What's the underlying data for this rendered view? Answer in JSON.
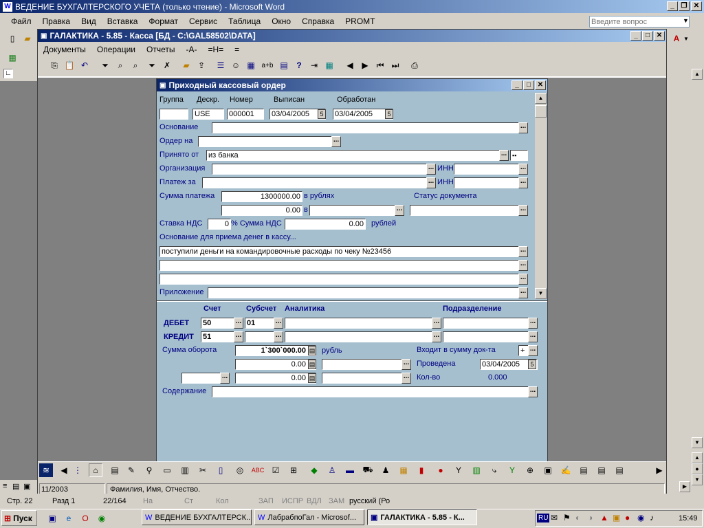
{
  "word": {
    "title": "ВЕДЕНИЕ БУХГАЛТЕРСКОГО УЧЕТА (только чтение) - Microsoft Word",
    "menu": [
      "Файл",
      "Правка",
      "Вид",
      "Вставка",
      "Формат",
      "Сервис",
      "Таблица",
      "Окно",
      "Справка",
      "PROMT"
    ],
    "help_placeholder": "Введите вопрос",
    "status": {
      "page": "Стр. 22",
      "section": "Разд 1",
      "pages": "22/164",
      "at": "На",
      "line": "Ст",
      "col": "Кол",
      "rec": "ЗАП",
      "trk": "ИСПР",
      "ext": "ВДЛ",
      "ovr": "ЗАМ",
      "lang": "русский (Ро"
    }
  },
  "galaktika": {
    "title": "ГАЛАКТИКА - 5.85 - Касса [БД - C:\\GAL58502\\DATA]",
    "menu": [
      "Документы",
      "Операции",
      "Отчеты",
      "-A-",
      "=H=",
      "="
    ],
    "status_period": "11/2003",
    "status_hint": "Фамилия, Имя, Отчество."
  },
  "order": {
    "title": "Приходный кассовый ордер",
    "labels": {
      "group": "Группа",
      "descr": "Дескр.",
      "number": "Номер",
      "issued": "Выписан",
      "processed": "Обработан",
      "basis": "Основание",
      "order_to": "Ордер на",
      "received_from": "Принято от",
      "organization": "Организация",
      "inn": "ИНН",
      "payment_for": "Платеж за",
      "payment_sum": "Сумма платежа",
      "in_rubles": "в рублях",
      "in": "в",
      "doc_status": "Статус документа",
      "vat_rate": "Ставка НДС",
      "vat_sum": "% Сумма НДС",
      "rubles": "рублей",
      "cash_basis": "Основание для приема денег в кассу...",
      "attachment": "Приложение"
    },
    "values": {
      "group": "",
      "descr": "USE",
      "number": "000001",
      "issued": "03/04/2005",
      "processed": "03/04/2005",
      "received_from": "из банка",
      "received_extra": "▪▪",
      "payment_sum": "1300000.00",
      "payment_sum2": "0.00",
      "vat_rate": "0",
      "vat_sum": "0.00",
      "cash_basis_1": "поступили деньги на командировочные расходы по чеку №23456"
    },
    "posting": {
      "h_account": "Счет",
      "h_subaccount": "Субсчет",
      "h_analytics": "Аналитика",
      "h_division": "Подразделение",
      "debit": "ДЕБЕТ",
      "credit": "КРЕДИТ",
      "debit_account": "50",
      "debit_sub": "01",
      "credit_account": "51",
      "credit_sub": "",
      "turnover_label": "Сумма оборота",
      "turnover": "1`300`000.00",
      "ruble": "рубль",
      "turnover2": "0.00",
      "turnover3": "0.00",
      "included_label": "Входит в сумму док-та",
      "included": "+",
      "posted_label": "Проведена",
      "posted": "03/04/2005",
      "qty_label": "Кол-во",
      "qty": "0.000",
      "content_label": "Содержание"
    }
  },
  "taskbar": {
    "start": "Пуск",
    "tasks": [
      "ВЕДЕНИЕ БУХГАЛТЕРСК...",
      "ЛабрабпоГал - Microsof...",
      "ГАЛАКТИКА - 5.85 - К..."
    ],
    "lang": "RU",
    "clock": "15:49"
  }
}
